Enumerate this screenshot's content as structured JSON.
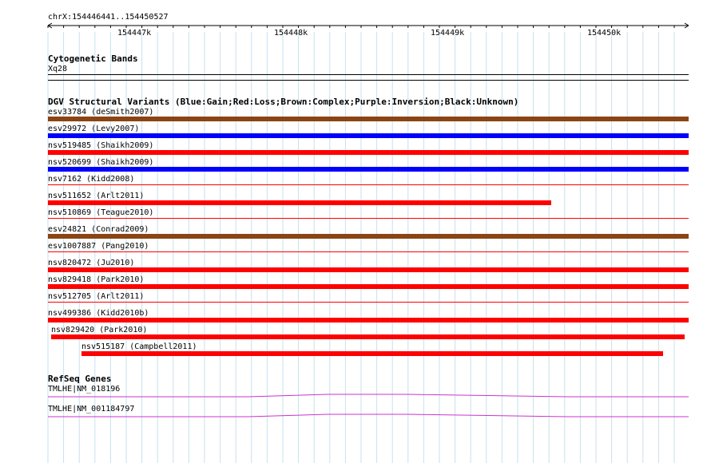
{
  "region": {
    "label": "chrX:154446441..154450527"
  },
  "ruler": {
    "ticks": [
      "154447k",
      "154448k",
      "154449k",
      "154450k"
    ]
  },
  "cytoband": {
    "title": "Cytogenetic Bands",
    "label": "Xq28"
  },
  "dgv": {
    "title": "DGV Structural Variants (Blue:Gain;Red:Loss;Brown:Complex;Purple:Inversion;Black:Unknown)",
    "colors": {
      "gain": "#0000ff",
      "loss": "#ff0000",
      "complex": "#8b4513"
    },
    "variants": [
      {
        "label": "esv33784 (deSmith2007)",
        "type": "complex"
      },
      {
        "label": "esv29972 (Levy2007)",
        "type": "gain"
      },
      {
        "label": "nsv519485 (Shaikh2009)",
        "type": "loss"
      },
      {
        "label": "nsv520699 (Shaikh2009)",
        "type": "gain"
      },
      {
        "label": "nsv7162 (Kidd2008)",
        "type": "loss"
      },
      {
        "label": "nsv511652 (Arlt2011)",
        "type": "loss"
      },
      {
        "label": "nsv510869 (Teague2010)",
        "type": "loss"
      },
      {
        "label": "esv24821 (Conrad2009)",
        "type": "complex"
      },
      {
        "label": "esv1007887 (Pang2010)",
        "type": "loss"
      },
      {
        "label": "nsv820472 (Ju2010)",
        "type": "loss"
      },
      {
        "label": "nsv829418 (Park2010)",
        "type": "loss"
      },
      {
        "label": "nsv512705 (Arlt2011)",
        "type": "loss"
      },
      {
        "label": "nsv499386 (Kidd2010b)",
        "type": "loss"
      },
      {
        "label": "nsv829420 (Park2010)",
        "type": "loss"
      },
      {
        "label": "nsv515187 (Campbell2011)",
        "type": "loss"
      }
    ]
  },
  "refseq": {
    "title": "RefSeq Genes",
    "genes": [
      {
        "label": "TMLHE|NM_018196",
        "color": "#cc33cc"
      },
      {
        "label": "TMLHE|NM_001184797",
        "color": "#cc33cc"
      }
    ]
  }
}
